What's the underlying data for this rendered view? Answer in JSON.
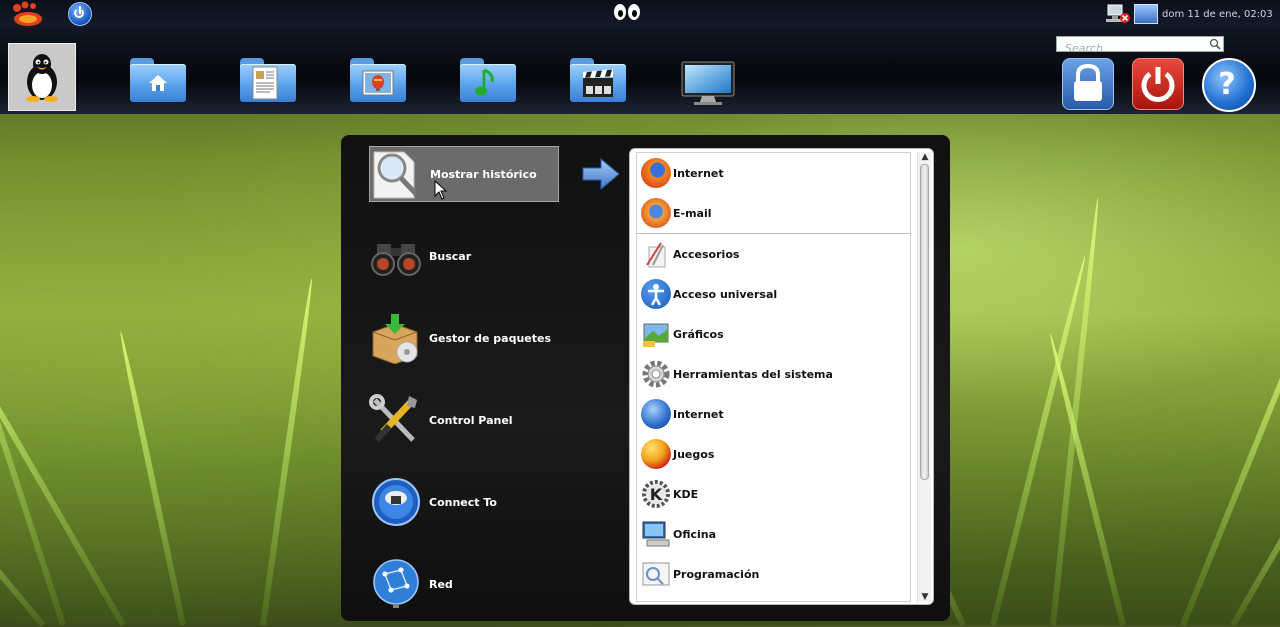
{
  "topbar": {
    "clock": "dom 11 de ene, 02:03"
  },
  "dock": {
    "search_placeholder": "Search",
    "items": [
      {
        "name": "home-folder",
        "icon": "home-icon"
      },
      {
        "name": "documents-folder",
        "icon": "document-icon"
      },
      {
        "name": "pictures-folder",
        "icon": "picture-icon"
      },
      {
        "name": "music-folder",
        "icon": "music-note-icon"
      },
      {
        "name": "videos-folder",
        "icon": "clapperboard-icon"
      },
      {
        "name": "desktop-monitor",
        "icon": "monitor-icon"
      }
    ],
    "system": [
      {
        "name": "lock-screen-button",
        "icon": "lock-icon",
        "color": "#3a6fb0"
      },
      {
        "name": "shutdown-button",
        "icon": "power-icon",
        "color": "#c0241e"
      },
      {
        "name": "help-button",
        "icon": "help-icon",
        "color": "#2c7fd8"
      }
    ]
  },
  "menu": {
    "categories": [
      {
        "label": "Mostrar histórico",
        "icon": "magnifier-icon",
        "selected": true
      },
      {
        "label": "Buscar",
        "icon": "binoculars-icon"
      },
      {
        "label": "Gestor de paquetes",
        "icon": "package-icon"
      },
      {
        "label": "Control Panel",
        "icon": "tools-icon"
      },
      {
        "label": "Connect To",
        "icon": "connect-icon"
      },
      {
        "label": "Red",
        "icon": "network-globe-icon"
      }
    ],
    "favorites": [
      {
        "label": "Internet",
        "icon": "firefox-icon"
      },
      {
        "label": "E-mail",
        "icon": "email-icon"
      }
    ],
    "apps": [
      {
        "label": "Accesorios",
        "icon": "accessories-icon"
      },
      {
        "label": "Acceso universal",
        "icon": "accessibility-icon"
      },
      {
        "label": "Gráficos",
        "icon": "graphics-icon"
      },
      {
        "label": "Herramientas del sistema",
        "icon": "gear-icon"
      },
      {
        "label": "Internet",
        "icon": "globe-icon"
      },
      {
        "label": "Juegos",
        "icon": "games-icon"
      },
      {
        "label": "KDE",
        "icon": "kde-icon"
      },
      {
        "label": "Oficina",
        "icon": "office-icon"
      },
      {
        "label": "Programación",
        "icon": "programming-icon"
      }
    ]
  }
}
